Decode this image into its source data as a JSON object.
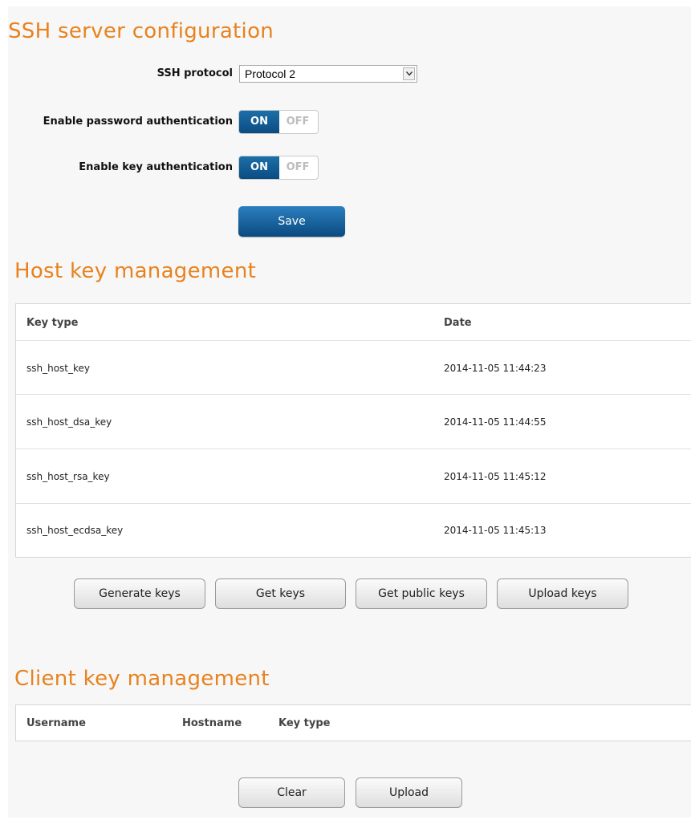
{
  "ssh_config": {
    "title": "SSH server configuration",
    "protocol_label": "SSH protocol",
    "protocol_value": "Protocol 2",
    "password_auth_label": "Enable password authentication",
    "key_auth_label": "Enable key authentication",
    "on_label": "ON",
    "off_label": "OFF",
    "password_auth_state": "ON",
    "key_auth_state": "ON",
    "save_label": "Save"
  },
  "host_keys": {
    "title": "Host key management",
    "columns": [
      "Key type",
      "Date"
    ],
    "rows": [
      {
        "key_type": "ssh_host_key",
        "date": "2014-11-05 11:44:23"
      },
      {
        "key_type": "ssh_host_dsa_key",
        "date": "2014-11-05 11:44:55"
      },
      {
        "key_type": "ssh_host_rsa_key",
        "date": "2014-11-05 11:45:12"
      },
      {
        "key_type": "ssh_host_ecdsa_key",
        "date": "2014-11-05 11:45:13"
      }
    ],
    "buttons": [
      "Generate keys",
      "Get keys",
      "Get public keys",
      "Upload keys"
    ]
  },
  "client_keys": {
    "title": "Client key management",
    "columns": [
      "Username",
      "Hostname",
      "Key type"
    ],
    "buttons": [
      "Clear",
      "Upload"
    ]
  },
  "colors": {
    "accent": "#e8821e",
    "primary_button": "#0a4a80",
    "toggle_on": "#1d6fa8"
  },
  "icons": {
    "dropdown": "chevron-down-icon"
  }
}
